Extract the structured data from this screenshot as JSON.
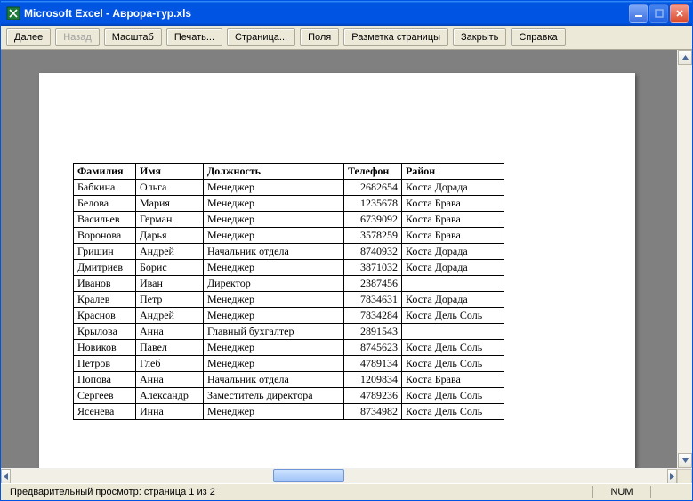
{
  "window": {
    "title": "Microsoft Excel - Аврора-тур.xls"
  },
  "toolbar": {
    "next": "Далее",
    "prev": "Назад",
    "zoom": "Масштаб",
    "print": "Печать...",
    "page": "Страница...",
    "margins": "Поля",
    "pagebreak": "Разметка страницы",
    "close": "Закрыть",
    "help": "Справка"
  },
  "table": {
    "headers": [
      "Фамилия",
      "Имя",
      "Должность",
      "Телефон",
      "Район"
    ],
    "rows": [
      [
        "Бабкина",
        "Ольга",
        "Менеджер",
        "2682654",
        "Коста Дорада"
      ],
      [
        "Белова",
        "Мария",
        "Менеджер",
        "1235678",
        "Коста Брава"
      ],
      [
        "Васильев",
        "Герман",
        "Менеджер",
        "6739092",
        "Коста Брава"
      ],
      [
        "Воронова",
        "Дарья",
        "Менеджер",
        "3578259",
        "Коста Брава"
      ],
      [
        "Гришин",
        "Андрей",
        "Начальник отдела",
        "8740932",
        "Коста Дорада"
      ],
      [
        "Дмитриев",
        "Борис",
        "Менеджер",
        "3871032",
        "Коста Дорада"
      ],
      [
        "Иванов",
        "Иван",
        "Директор",
        "2387456",
        ""
      ],
      [
        "Кралев",
        "Петр",
        "Менеджер",
        "7834631",
        "Коста Дорада"
      ],
      [
        "Краснов",
        "Андрей",
        "Менеджер",
        "7834284",
        "Коста Дель Соль"
      ],
      [
        "Крылова",
        "Анна",
        "Главный бухгалтер",
        "2891543",
        ""
      ],
      [
        "Новиков",
        "Павел",
        "Менеджер",
        "8745623",
        "Коста Дель Соль"
      ],
      [
        "Петров",
        "Глеб",
        "Менеджер",
        "4789134",
        "Коста Дель Соль"
      ],
      [
        "Попова",
        "Анна",
        "Начальник отдела",
        "1209834",
        "Коста Брава"
      ],
      [
        "Сергеев",
        "Александр",
        "Заместитель директора",
        "4789236",
        "Коста Дель Соль"
      ],
      [
        "Ясенева",
        "Инна",
        "Менеджер",
        "8734982",
        "Коста Дель Соль"
      ]
    ]
  },
  "status": {
    "left": "Предварительный просмотр: страница 1 из 2",
    "num": "NUM"
  }
}
